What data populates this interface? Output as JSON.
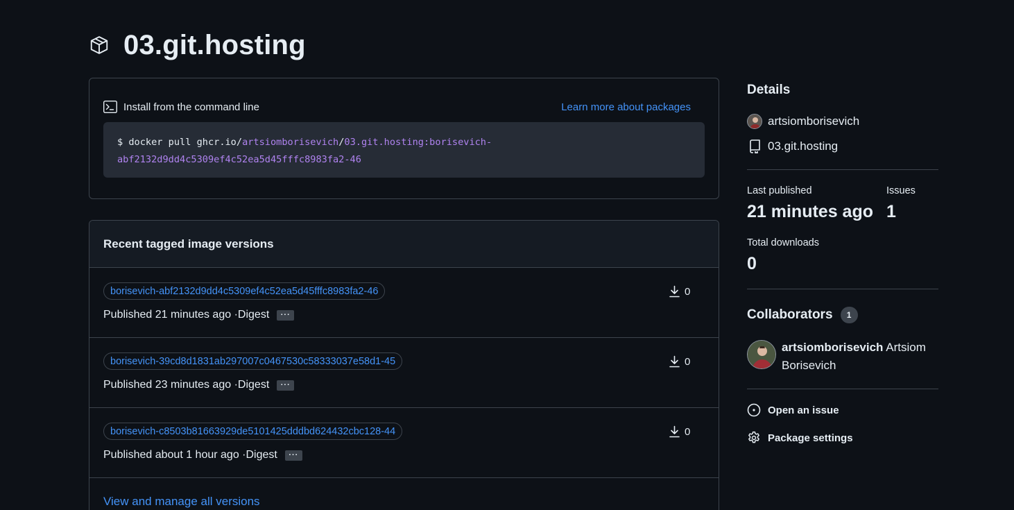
{
  "package": {
    "name": "03.git.hosting",
    "icon": "package-icon"
  },
  "install": {
    "title": "Install from the command line",
    "learn_more": "Learn more about packages",
    "cmd_prefix": "$ docker pull ghcr.io/",
    "cmd_owner": "artsiomborisevich",
    "cmd_slash": "/",
    "cmd_image_line1": "03.git.hosting:borisevich-",
    "cmd_image_line2": "abf2132d9dd4c5309ef4c52ea5d45fffc8983fa2-46"
  },
  "versions": {
    "heading": "Recent tagged image versions",
    "digest_label": "Digest",
    "digest_button": "···",
    "items": [
      {
        "tag": "borisevich-abf2132d9dd4c5309ef4c52ea5d45fffc8983fa2-46",
        "published": "Published 21 minutes ago · ",
        "downloads": "0"
      },
      {
        "tag": "borisevich-39cd8d1831ab297007c0467530c58333037e58d1-45",
        "published": "Published 23 minutes ago · ",
        "downloads": "0"
      },
      {
        "tag": "borisevich-c8503b81663929de5101425dddbd624432cbc128-44",
        "published": "Published about 1 hour ago · ",
        "downloads": "0"
      }
    ],
    "view_all": "View and manage all versions"
  },
  "sidebar": {
    "details_title": "Details",
    "owner": "artsiomborisevich",
    "repo": "03.git.hosting",
    "last_published_label": "Last published",
    "last_published_value": "21 minutes ago",
    "issues_label": "Issues",
    "issues_value": "1",
    "downloads_label": "Total downloads",
    "downloads_value": "0",
    "collaborators_title": "Collaborators",
    "collaborators_count": "1",
    "collaborator_login": "artsiomborisevich",
    "collaborator_name": "Artsiom Borisevich",
    "open_issue": "Open an issue",
    "package_settings": "Package settings"
  },
  "colors": {
    "background": "#0d1117",
    "link": "#4493f8",
    "purple": "#b083f0",
    "border": "#3d444d"
  }
}
